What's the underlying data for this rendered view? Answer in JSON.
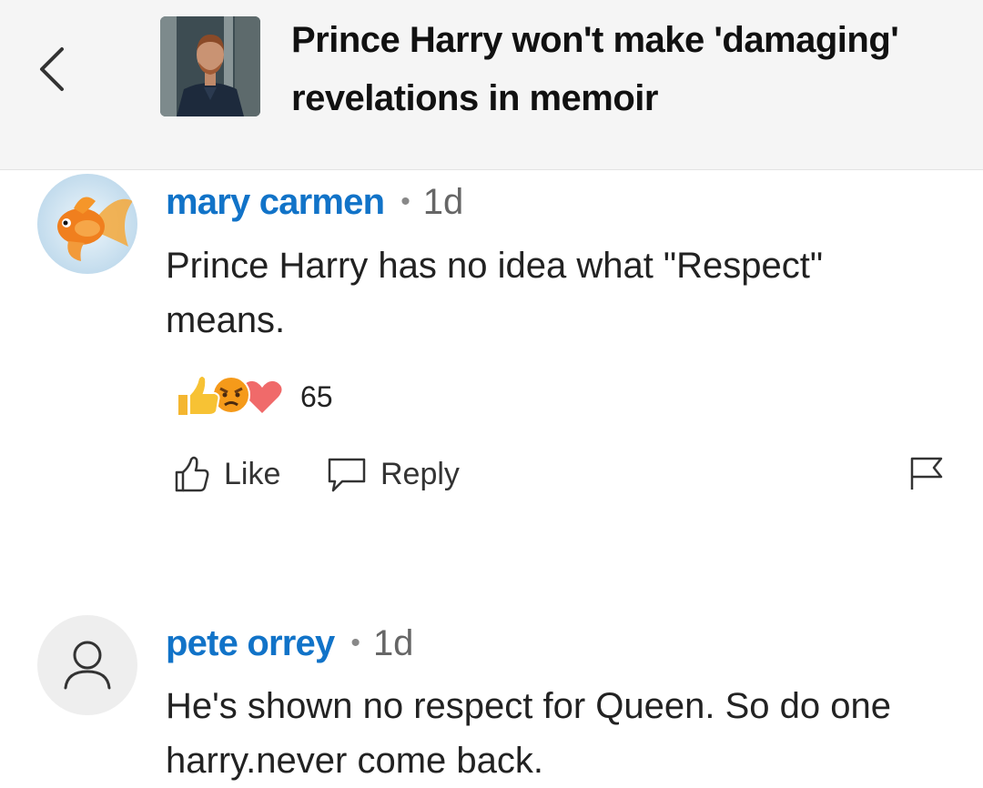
{
  "header": {
    "back_icon": "chevron-left-icon",
    "article_title": "Prince Harry won't make 'damaging' revelations in memoir"
  },
  "comments": [
    {
      "author": "mary carmen",
      "separator": "•",
      "time": "1d",
      "text": "Prince Harry has no idea what \"Respect\" means.",
      "reaction_icons": [
        "thumbs-up-icon",
        "angry-face-icon",
        "heart-icon"
      ],
      "reaction_count": "65",
      "like_label": "Like",
      "reply_label": "Reply",
      "flag_icon": "flag-icon"
    },
    {
      "author": "pete orrey",
      "separator": "•",
      "time": "1d",
      "text": "He's shown no respect for Queen. So do one harry.never come back."
    }
  ],
  "colors": {
    "author_link": "#1173c8",
    "header_bg": "#f5f5f5"
  }
}
